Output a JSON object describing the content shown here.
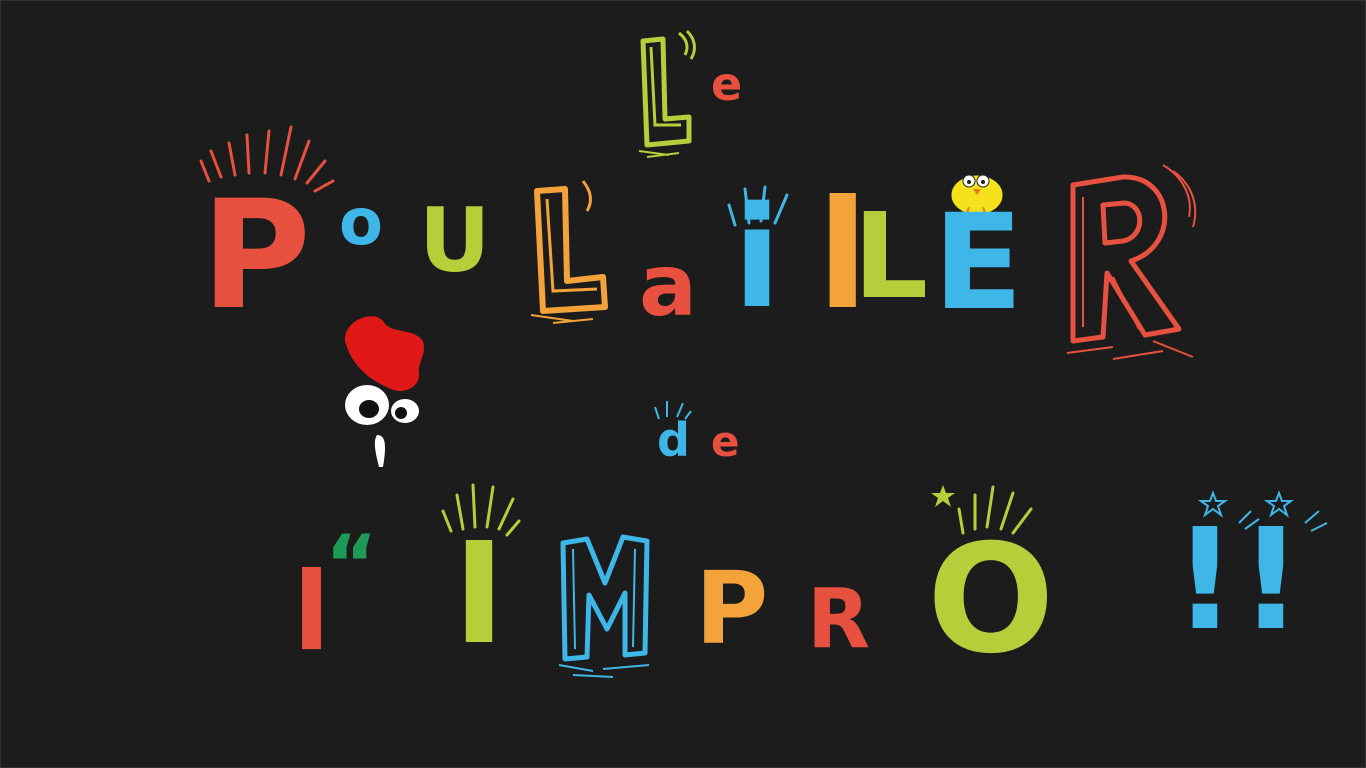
{
  "title": {
    "line1": "Le",
    "line2": "PouLailLER",
    "line3": "de",
    "line4_prefix": "L",
    "line4_quote": "“",
    "line4_word": "IMPRO",
    "line4_exclaim": "!!"
  },
  "letters": {
    "L1": "L",
    "e1": "e",
    "P": "P",
    "o": "o",
    "u": "U",
    "L2": "L",
    "a": "a",
    "i": "i",
    "l3": "l",
    "L4": "L",
    "E": "E",
    "R": "R",
    "d": "d",
    "e2": "e",
    "l5": "l",
    "quote": "“",
    "I": "I",
    "M": "M",
    "P2": "P",
    "R2": "R",
    "O": "O",
    "ex1": "!",
    "ex2": "!"
  },
  "colors": {
    "background": "#1c1c1c",
    "red": "#e8503f",
    "blue": "#3fb6e8",
    "green": "#b7cd3a",
    "orange": "#f4a23a",
    "chick_yellow": "#f5e21c",
    "rooster_comb": "#e01818",
    "quote_green": "#1e9a57"
  },
  "icons": [
    "rooster-head-icon",
    "chick-icon",
    "star-icon"
  ]
}
